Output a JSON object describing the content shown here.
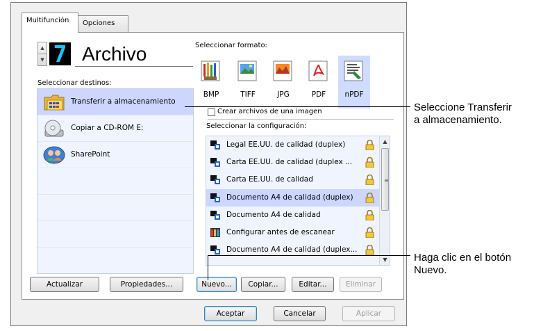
{
  "tabs": [
    {
      "label": "Multifunción",
      "active": true
    },
    {
      "label": "Opciones",
      "active": false
    }
  ],
  "destination_header": {
    "lcd_digit": "7",
    "title": "Archivo"
  },
  "labels": {
    "select_destinations": "Seleccionar destinos:",
    "select_format": "Seleccionar formato:",
    "single_image_files": "Crear archivos de una imagen",
    "select_configuration": "Seleccionar la configuración:"
  },
  "destinations": [
    {
      "label": "Transferir a almacenamiento",
      "icon": "folder-transfer-icon",
      "selected": true
    },
    {
      "label": "Copiar a CD-ROM  E:",
      "icon": "cd-rom-icon",
      "selected": false
    },
    {
      "label": "SharePoint",
      "icon": "sharepoint-icon",
      "selected": false
    }
  ],
  "formats": [
    {
      "label": "BMP",
      "icon": "bmp-icon",
      "selected": false
    },
    {
      "label": "TIFF",
      "icon": "tiff-icon",
      "selected": false
    },
    {
      "label": "JPG",
      "icon": "jpg-icon",
      "selected": false
    },
    {
      "label": "PDF",
      "icon": "pdf-icon",
      "selected": false
    },
    {
      "label": "nPDF",
      "icon": "npdf-icon",
      "selected": true
    }
  ],
  "single_image_files_checked": false,
  "configurations": [
    {
      "label": "Legal EE.UU. de calidad (duplex)",
      "icon": "scanner-config-icon",
      "selected": false
    },
    {
      "label": "Carta EE.UU. de calidad (duplex ...",
      "icon": "scanner-config-icon",
      "selected": false
    },
    {
      "label": "Carta EE.UU. de calidad",
      "icon": "scanner-config-icon",
      "selected": false
    },
    {
      "label": "Documento A4 de calidad (duplex)",
      "icon": "scanner-config-icon",
      "selected": true
    },
    {
      "label": "Documento A4 de calidad",
      "icon": "scanner-config-icon",
      "selected": false
    },
    {
      "label": "Configurar antes de escanear",
      "icon": "configure-before-scan-icon",
      "selected": false
    },
    {
      "label": "Documento A4 de calidad (duplex...",
      "icon": "scanner-config-icon",
      "selected": false
    }
  ],
  "buttons": {
    "refresh": "Actualizar",
    "properties": "Propiedades...",
    "new": "Nuevo...",
    "copy": "Copiar...",
    "edit": "Editar...",
    "delete": "Eliminar",
    "ok": "Aceptar",
    "cancel": "Cancelar",
    "apply": "Aplicar"
  },
  "callouts": {
    "transfer_line1": "Seleccione Transferir",
    "transfer_line2": "a almacenamiento.",
    "new_line1": "Haga clic en el botón",
    "new_line2": "Nuevo."
  },
  "colors": {
    "selection": "#cdd6ff",
    "list_background": "#f0f4ff",
    "lcd_digit": "#15c5ff"
  }
}
